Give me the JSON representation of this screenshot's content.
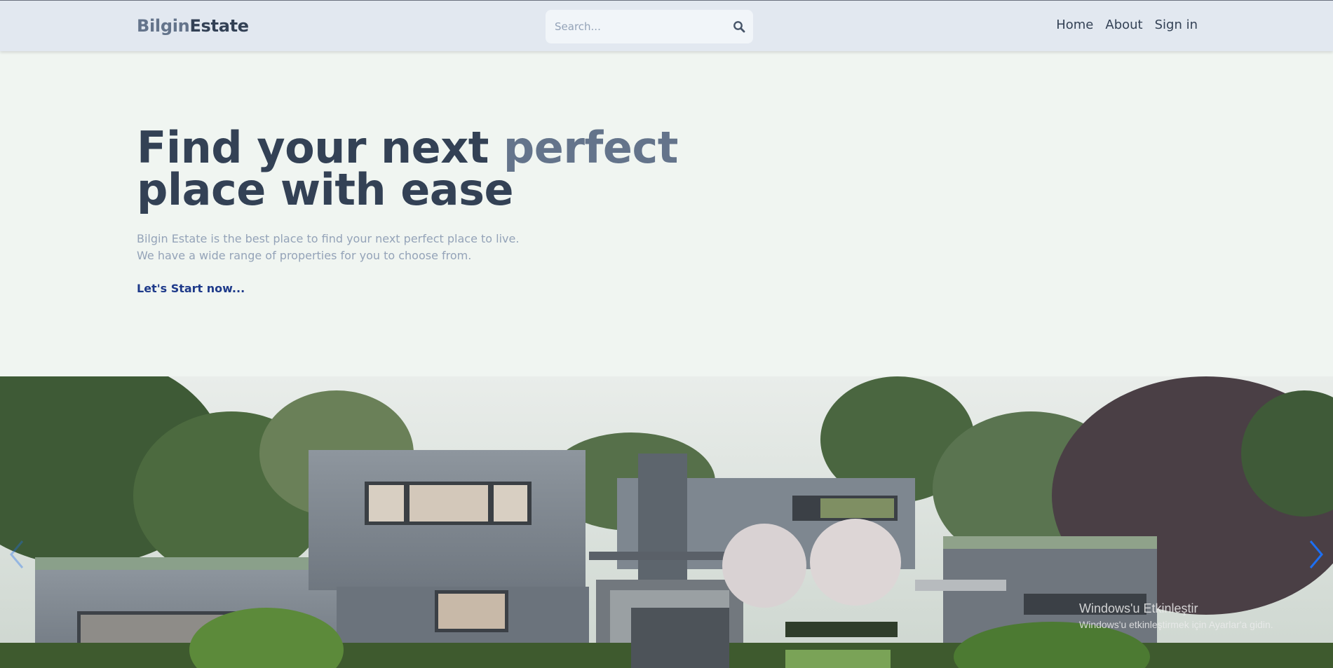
{
  "brand": {
    "part1": "Bilgin",
    "part2": "Estate"
  },
  "search": {
    "placeholder": "Search...",
    "value": ""
  },
  "nav": {
    "home": "Home",
    "about": "About",
    "signin": "Sign in"
  },
  "hero": {
    "title_start": "Find your next ",
    "title_highlight": "perfect",
    "title_end": "place with ease",
    "desc_line1": "Bilgin Estate is the best place to find your next perfect place to live.",
    "desc_line2": "We have a wide range of properties for you to choose from.",
    "cta": "Let's Start now..."
  },
  "carousel": {
    "image": "modern house exterior with green roof and garden",
    "prev_icon": "chevron-left-icon",
    "next_icon": "chevron-right-icon"
  },
  "watermark": {
    "title": "Windows'u Etkinleştir",
    "subtitle": "Windows'u etkinleştirmek için Ayarlar'a gidin."
  },
  "colors": {
    "header_bg": "#e2e8f0",
    "hero_bg": "#f0f5f1",
    "brand_primary": "#334155",
    "brand_secondary": "#64748b",
    "cta": "#1e3a8a",
    "carousel_arrow": "#1d6ff2"
  }
}
